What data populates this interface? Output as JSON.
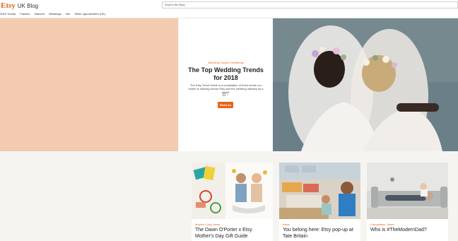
{
  "header": {
    "logo_brand": "Etsy",
    "logo_suffix": "UK Blog",
    "search_placeholder": "Search the Blog"
  },
  "nav": {
    "items": [
      "2018 Trends",
      "Fashion",
      "Interiors",
      "Weddings",
      "Info",
      "Seller opportunities (UK)"
    ]
  },
  "hero": {
    "category": "Wedding Guides | Weddings",
    "title": "The Top Wedding Trends for 2018",
    "description": "The Etsy Trend Guide is a compilation of fresh trends our expert is noticing across Etsy and the wedding industry as a whole.",
    "share_count": "1",
    "button_label": "Read on"
  },
  "cards": [
    {
      "category": "Mother's Day, News",
      "title": "The Dawn O'Porter x Etsy Mother's Day Gift Guide"
    },
    {
      "category": "News",
      "title": "You belong here: Etsy pop-up at Tate Britain"
    },
    {
      "category": "Competition, News",
      "title": "Who is #TheModernDad?"
    }
  ],
  "colors": {
    "accent": "#e8641b",
    "peach": "#f2cbb1",
    "background": "#f5f4f0"
  }
}
